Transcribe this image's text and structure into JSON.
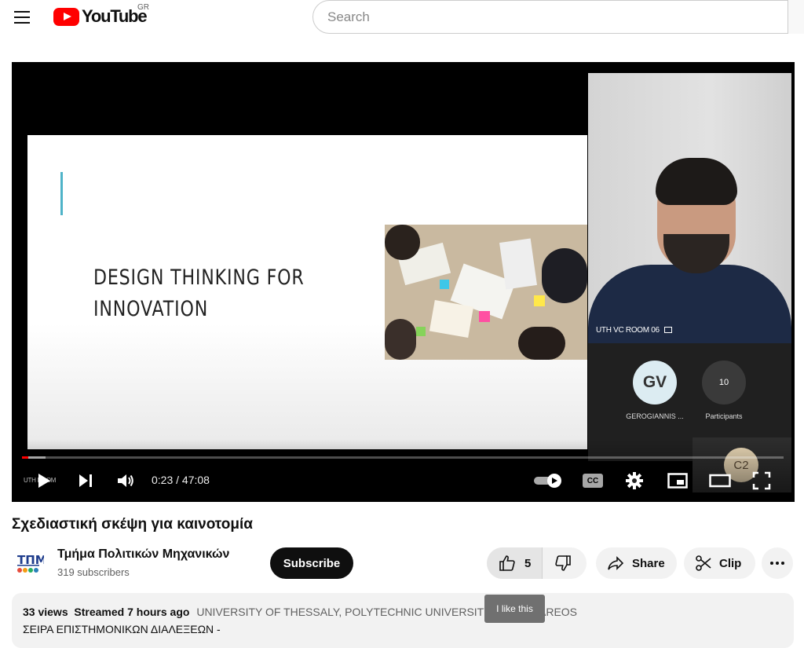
{
  "header": {
    "logo_text": "YouTube",
    "country_code": "GR",
    "search_placeholder": "Search"
  },
  "player": {
    "slide_title_line1": "DESIGN THINKING FOR",
    "slide_title_line2": "INNOVATION",
    "video_tile_label": "UTH VC ROOM 06",
    "participant_initials": "GV",
    "participant_name": "GEROGIANNIS ...",
    "participants_count": "10",
    "participants_label": "Participants",
    "self_tile_initials": "C2",
    "background_tag": "UTH ROOM",
    "current_time": "0:23",
    "duration": "47:08",
    "time_display": "0:23 / 47:08",
    "progress_played_fraction": 0.008,
    "progress_buffered_fraction": 0.031,
    "captions_label": "CC"
  },
  "video": {
    "title": "Σχεδιαστική σκέψη για καινοτομία",
    "channel_name": "Τμήμα Πολιτικών Μηχανικών",
    "subscribers": "319 subscribers",
    "subscribe_label": "Subscribe",
    "like_count": "5",
    "share_label": "Share",
    "clip_label": "Clip",
    "like_tooltip": "I like this"
  },
  "description": {
    "views": "33 views",
    "streamed": "Streamed 7 hours ago",
    "tags": "UNIVERSITY OF THESSALY, POLYTECHNIC UNIVERSITY PEDION AREOS",
    "line2": "ΣΕΙΡΑ ΕΠΙΣΤΗΜΟΝΙΚΩΝ ΔΙΑΛΕΞΕΩΝ -"
  },
  "colors": {
    "brand_red": "#ff0000",
    "slide_accent": "#4fb3c8",
    "subscribe_bg": "#0f0f0f"
  }
}
